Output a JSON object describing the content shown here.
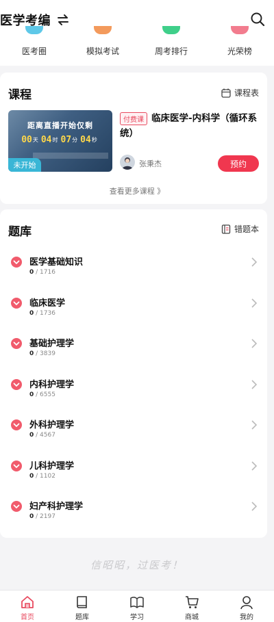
{
  "header": {
    "brand": "医学考编"
  },
  "quick_nav": [
    {
      "label": "医考圈",
      "color": "#5ec8e8"
    },
    {
      "label": "模拟考试",
      "color": "#f39a5c"
    },
    {
      "label": "周考排行",
      "color": "#3fcf8a"
    },
    {
      "label": "光荣榜",
      "color": "#f27c8e"
    }
  ],
  "course": {
    "section_title": "课程",
    "schedule_link": "课程表",
    "banner": {
      "heading": "距离直播开始仅剩",
      "countdown": {
        "days": "00",
        "hours": "04",
        "minutes": "07",
        "seconds": "04"
      },
      "units": {
        "days": "天",
        "hours": "时",
        "minutes": "分",
        "seconds": "秒"
      },
      "status": "未开始"
    },
    "badge": "付费课",
    "title": "临床医学-内科学（循环系统）",
    "teacher": "张秉杰",
    "reserve_label": "预约",
    "more_label": "查看更多课程 》",
    "accent": "#f0374f"
  },
  "question_bank": {
    "section_title": "题库",
    "wrong_link": "错题本",
    "items": [
      {
        "name": "医学基础知识",
        "done": "0",
        "total": "/ 1716"
      },
      {
        "name": "临床医学",
        "done": "0",
        "total": "/ 1736"
      },
      {
        "name": "基础护理学",
        "done": "0",
        "total": "/ 3839"
      },
      {
        "name": "内科护理学",
        "done": "0",
        "total": "/ 6555"
      },
      {
        "name": "外科护理学",
        "done": "0",
        "total": "/ 4567"
      },
      {
        "name": "儿科护理学",
        "done": "0",
        "total": "/ 1102"
      },
      {
        "name": "妇产科护理学",
        "done": "0",
        "total": "/ 2197"
      }
    ]
  },
  "slogan": "信昭昭，过医考！",
  "tabbar": [
    {
      "label": "首页",
      "icon": "home-icon",
      "active": true
    },
    {
      "label": "题库",
      "icon": "book-icon",
      "active": false
    },
    {
      "label": "学习",
      "icon": "open-book-icon",
      "active": false
    },
    {
      "label": "商城",
      "icon": "cart-icon",
      "active": false
    },
    {
      "label": "我的",
      "icon": "profile-icon",
      "active": false
    }
  ]
}
